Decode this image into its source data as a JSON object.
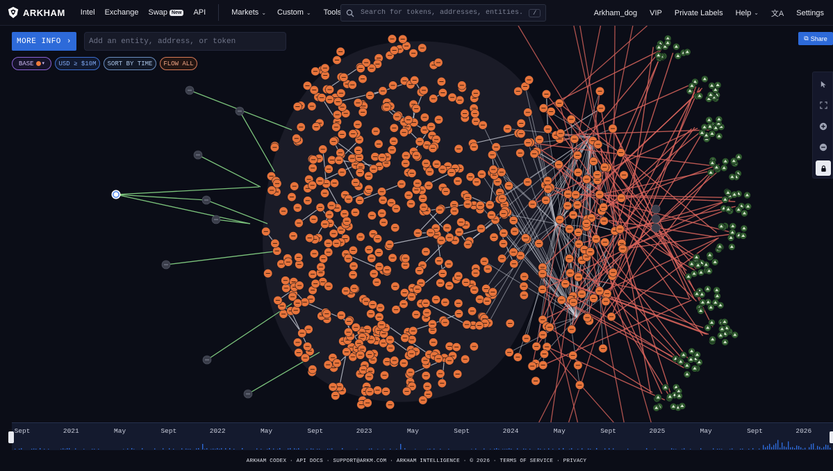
{
  "nav": {
    "logo_text": "ARKHAM",
    "links": [
      "Intel",
      "Exchange",
      "Swap",
      "API"
    ],
    "swap_badge": "New",
    "menus": [
      "Markets",
      "Custom",
      "Tools"
    ],
    "search_placeholder": "Search for tokens, addresses, entities...",
    "search_shortcut": "/",
    "right_links": [
      "Arkham_dog",
      "VIP",
      "Private Labels"
    ],
    "help_label": "Help",
    "translate_icon": "translate-icon",
    "settings_label": "Settings"
  },
  "controls": {
    "more_info_label": "MORE INFO",
    "entity_placeholder": "Add an entity, address, or token",
    "chips": {
      "base": "BASE",
      "usd": "USD ≥ $10M",
      "sort": "SORT BY TIME",
      "flow": "FLOW ALL"
    }
  },
  "toolbar": {
    "share_label": "Share",
    "tools": [
      "pointer-icon",
      "fit-screen-icon",
      "zoom-in-icon",
      "zoom-out-icon",
      "lock-icon"
    ]
  },
  "graph": {
    "colors": {
      "background": "#0b0d17",
      "node_orange": "#e8743b",
      "edge_internal": "#c9ccd6",
      "edge_outflow": "#d9645c",
      "edge_inflow": "#7cc47c",
      "node_gray": "#3b3e4b",
      "node_green": "#2f5a2e",
      "selected_ring": "#5b8ff0"
    }
  },
  "timeline": {
    "labels": [
      "Sept",
      "2021",
      "May",
      "Sept",
      "2022",
      "May",
      "Sept",
      "2023",
      "May",
      "Sept",
      "2024",
      "May",
      "Sept",
      "2025",
      "May",
      "Sept",
      "2026"
    ],
    "accent": "#2d6ad9"
  },
  "footer": {
    "items": [
      "ARKHAM CODEX",
      "API DOCS",
      "SUPPORT@ARKM.COM",
      "ARKHAM INTELLIGENCE",
      "© 2026",
      "TERMS OF SERVICE",
      "PRIVACY"
    ],
    "separator": "·"
  }
}
